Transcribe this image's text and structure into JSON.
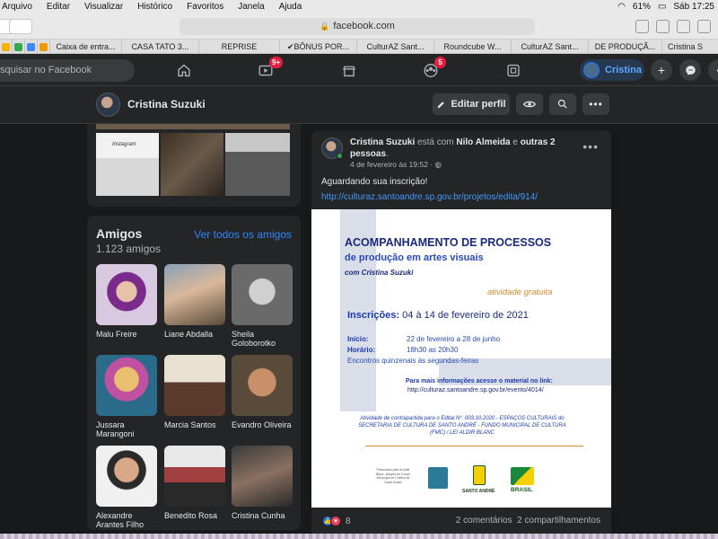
{
  "menubar": {
    "items": [
      "Arquivo",
      "Editar",
      "Visualizar",
      "Histórico",
      "Favoritos",
      "Janela",
      "Ajuda"
    ],
    "battery": "61%",
    "clock": "Sáb 17:25"
  },
  "browser": {
    "url": "facebook.com"
  },
  "bookmarks": [
    "Caixa de entra...",
    "CASA TATO 3...",
    "REPRISE",
    "✔BÔNUS POR...",
    "CulturAZ Sant...",
    "Roundcube W...",
    "CulturAZ Sant...",
    "DE PRODUÇÃ...",
    "Cristina S"
  ],
  "fbnav": {
    "search_placeholder": "squisar no Facebook",
    "watch_badge": "9+",
    "groups_badge": "5",
    "profile_name": "Cristina"
  },
  "subheader": {
    "name": "Cristina Suzuki",
    "edit_label": "Editar perfil"
  },
  "photos": {
    "insta_label": "Instagram"
  },
  "friends": {
    "title": "Amigos",
    "count": "1.123 amigos",
    "see_all": "Ver todos os amigos",
    "items": [
      {
        "name": "Malu Freire"
      },
      {
        "name": "Liane Abdalla"
      },
      {
        "name": "Sheila Goloborotko"
      },
      {
        "name": "Jussara Marangoni"
      },
      {
        "name": "Marcia Santos"
      },
      {
        "name": "Evandro Oliveira"
      },
      {
        "name": "Alexandre Arantes Filho"
      },
      {
        "name": "Benedito Rosa"
      },
      {
        "name": "Cristina Cunha"
      }
    ]
  },
  "post": {
    "author": "Cristina Suzuki",
    "with_text": " está com ",
    "tagged": "Nilo Almeida",
    "and_text": " e ",
    "others": "outras 2 pessoas",
    "period": ".",
    "date": "4 de fevereiro às 19:52 · ",
    "text": "Aguardando sua inscrição!",
    "link": "http://culturaz.santoandre.sp.gov.br/projetos/edita/914/",
    "reaction_count": "8",
    "comments": "2 comentários",
    "shares": "2 compartilhamentos"
  },
  "poster": {
    "title": "ACOMPANHAMENTO DE PROCESSOS",
    "subtitle": "de produção em artes visuais",
    "with": "com Cristina Suzuki",
    "free": "atividade gratuita",
    "insc_label": "Inscrições:",
    "insc_dates": " 04 à 14 de fevereiro de 2021",
    "inicio_label": "Início:",
    "inicio_value": "22 de fevereiro a 28 de junho",
    "horario_label": "Horário:",
    "horario_value": "18h30 as 20h30",
    "encontros": "Encontros quinzenais às segundas-feiras",
    "more_info": "Para mais informações acesse o material no link:",
    "more_url": "http://culturaz.santoandre.sp.gov.br/evento/4014/",
    "footer": "Atividade de contrapartida para o Edital Nº. 003.10.2020 - ESPAÇOS CULTURAIS do SECRETARIA DE CULTURA DE SANTO ANDRÉ - FUNDO MUNICIPAL DE CULTURA (FMC) / LEI ALDIR BLANC",
    "logo_text": "Financiado pela lei Aldir Blanc, através do Fundo Municipal de Cultura de Santo André",
    "santo_andre": "SANTO ANDRÉ",
    "brasil": "BRASIL",
    "colors": {
      "navy": "#1a2a7a",
      "blue": "#2a4ab8",
      "orange": "#d48a2a",
      "band": "#d9dee9"
    }
  }
}
